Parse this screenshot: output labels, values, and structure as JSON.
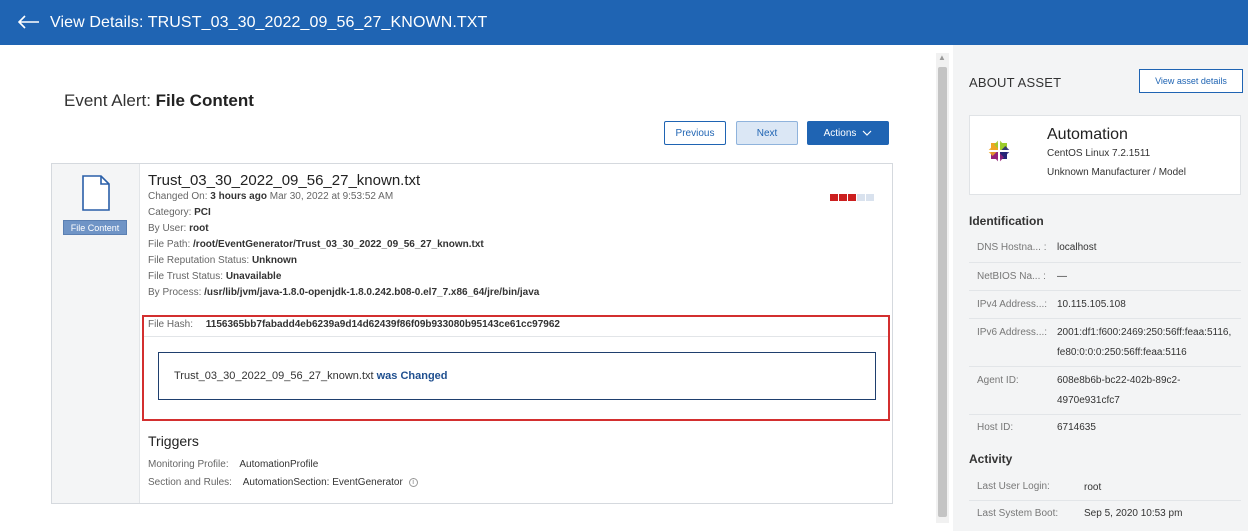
{
  "header": {
    "title": "View Details: TRUST_03_30_2022_09_56_27_KNOWN.TXT"
  },
  "event": {
    "label": "Event Alert:",
    "value": "File Content"
  },
  "buttons": {
    "previous": "Previous",
    "next": "Next",
    "actions": "Actions"
  },
  "card": {
    "badge": "File Content",
    "filename": "Trust_03_30_2022_09_56_27_known.txt",
    "changed_on_label": "Changed On:",
    "changed_on_value": "3 hours ago",
    "changed_on_date": "Mar 30, 2022 at 9:53:52 AM",
    "category_label": "Category:",
    "category_value": "PCI",
    "by_user_label": "By User:",
    "by_user_value": "root",
    "file_path_label": "File Path:",
    "file_path_value": "/root/EventGenerator/Trust_03_30_2022_09_56_27_known.txt",
    "reputation_label": "File Reputation Status:",
    "reputation_value": "Unknown",
    "trust_label": "File Trust Status:",
    "trust_value": "Unavailable",
    "process_label": "By Process:",
    "process_value": "/usr/lib/jvm/java-1.8.0-openjdk-1.8.0.242.b08-0.el7_7.x86_64/jre/bin/java",
    "hash_label": "File Hash:",
    "hash_value": "1156365bb7fabadd4eb6239a9d14d62439f86f09b933080b95143ce61cc97962",
    "change_file": "Trust_03_30_2022_09_56_27_known.txt",
    "change_status": "was Changed",
    "risk_colors": [
      "#cc1f1f",
      "#cc1f1f",
      "#cc1f1f",
      "#d9e2ee",
      "#d9e2ee"
    ],
    "triggers_title": "Triggers",
    "monitoring_label": "Monitoring Profile:",
    "monitoring_value": "AutomationProfile",
    "section_label": "Section and Rules:",
    "section_value": "AutomationSection: EventGenerator"
  },
  "sidebar": {
    "about_title": "ABOUT ASSET",
    "view_button": "View asset details",
    "asset_name": "Automation",
    "asset_os": "CentOS Linux 7.2.1511",
    "asset_mfr": "Unknown Manufacturer / Model",
    "identification_title": "Identification",
    "dns_label": "DNS Hostna...  :",
    "dns_value": "localhost",
    "netbios_label": "NetBIOS Na...  :",
    "netbios_value": "—",
    "ipv4_label": "IPv4 Address...:",
    "ipv4_value": "10.115.105.108",
    "ipv6_label": "IPv6 Address...:",
    "ipv6_value_1": "2001:df1:f600:2469:250:56ff:feaa:5116,",
    "ipv6_value_2": "fe80:0:0:0:250:56ff:feaa:5116",
    "agent_label": "Agent ID:",
    "agent_value_1": "608e8b6b-bc22-402b-89c2-",
    "agent_value_2": "4970e931cfc7",
    "host_label": "Host ID:",
    "host_value": "6714635",
    "activity_title": "Activity",
    "last_login_label": "Last User Login:",
    "last_login_value": "root",
    "last_boot_label": "Last System Boot:",
    "last_boot_value": "Sep 5, 2020 10:53 pm"
  }
}
